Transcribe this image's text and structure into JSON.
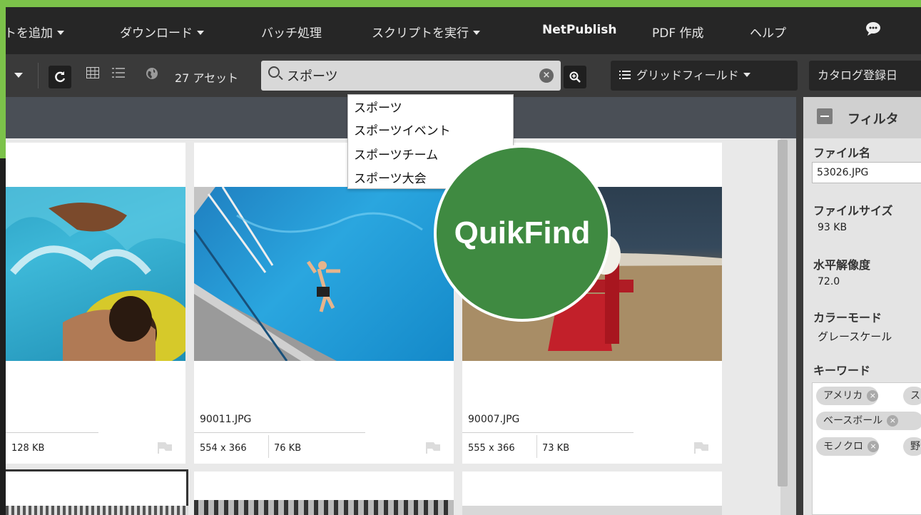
{
  "menu": {
    "items": [
      "トを追加",
      "ダウンロード",
      "バッチ処理",
      "スクリプトを実行",
      "NetPublish",
      "PDF 作成",
      "ヘルプ"
    ],
    "chat_icon": "speech-bubble-icon"
  },
  "toolbar": {
    "asset_count": "27 アセット",
    "search_value": "スポーツ",
    "grid_fields_label": "グリッドフィールド",
    "sort_label": "カタログ登録日"
  },
  "suggestions": [
    "スポーツ",
    "スポーツイベント",
    "スポーツチーム",
    "スポーツ大会"
  ],
  "badge": {
    "label": "QuikFind",
    "color": "#3f8a41"
  },
  "cards": [
    {
      "filename": "",
      "dimensions": "",
      "size": "128 KB"
    },
    {
      "filename": "90011.JPG",
      "dimensions": "554 x 366",
      "size": "76 KB"
    },
    {
      "filename": "90007.JPG",
      "dimensions": "555 x 366",
      "size": "73 KB"
    }
  ],
  "filter": {
    "title": "フィルタ",
    "file_name_label": "ファイル名",
    "file_name_value": "53026.JPG",
    "file_size_label": "ファイルサイズ",
    "file_size_value": "93 KB",
    "h_res_label": "水平解像度",
    "h_res_value": "72.0",
    "color_mode_label": "カラーモード",
    "color_mode_value": "グレースケール",
    "keywords_label": "キーワード",
    "keywords": [
      "アメリカ",
      "ス",
      "ベースボール",
      "モノクロ",
      "野"
    ]
  },
  "colors": {
    "frame": "#7cc24a",
    "menubar": "#262626",
    "toolbar": "#3a3a3a"
  }
}
